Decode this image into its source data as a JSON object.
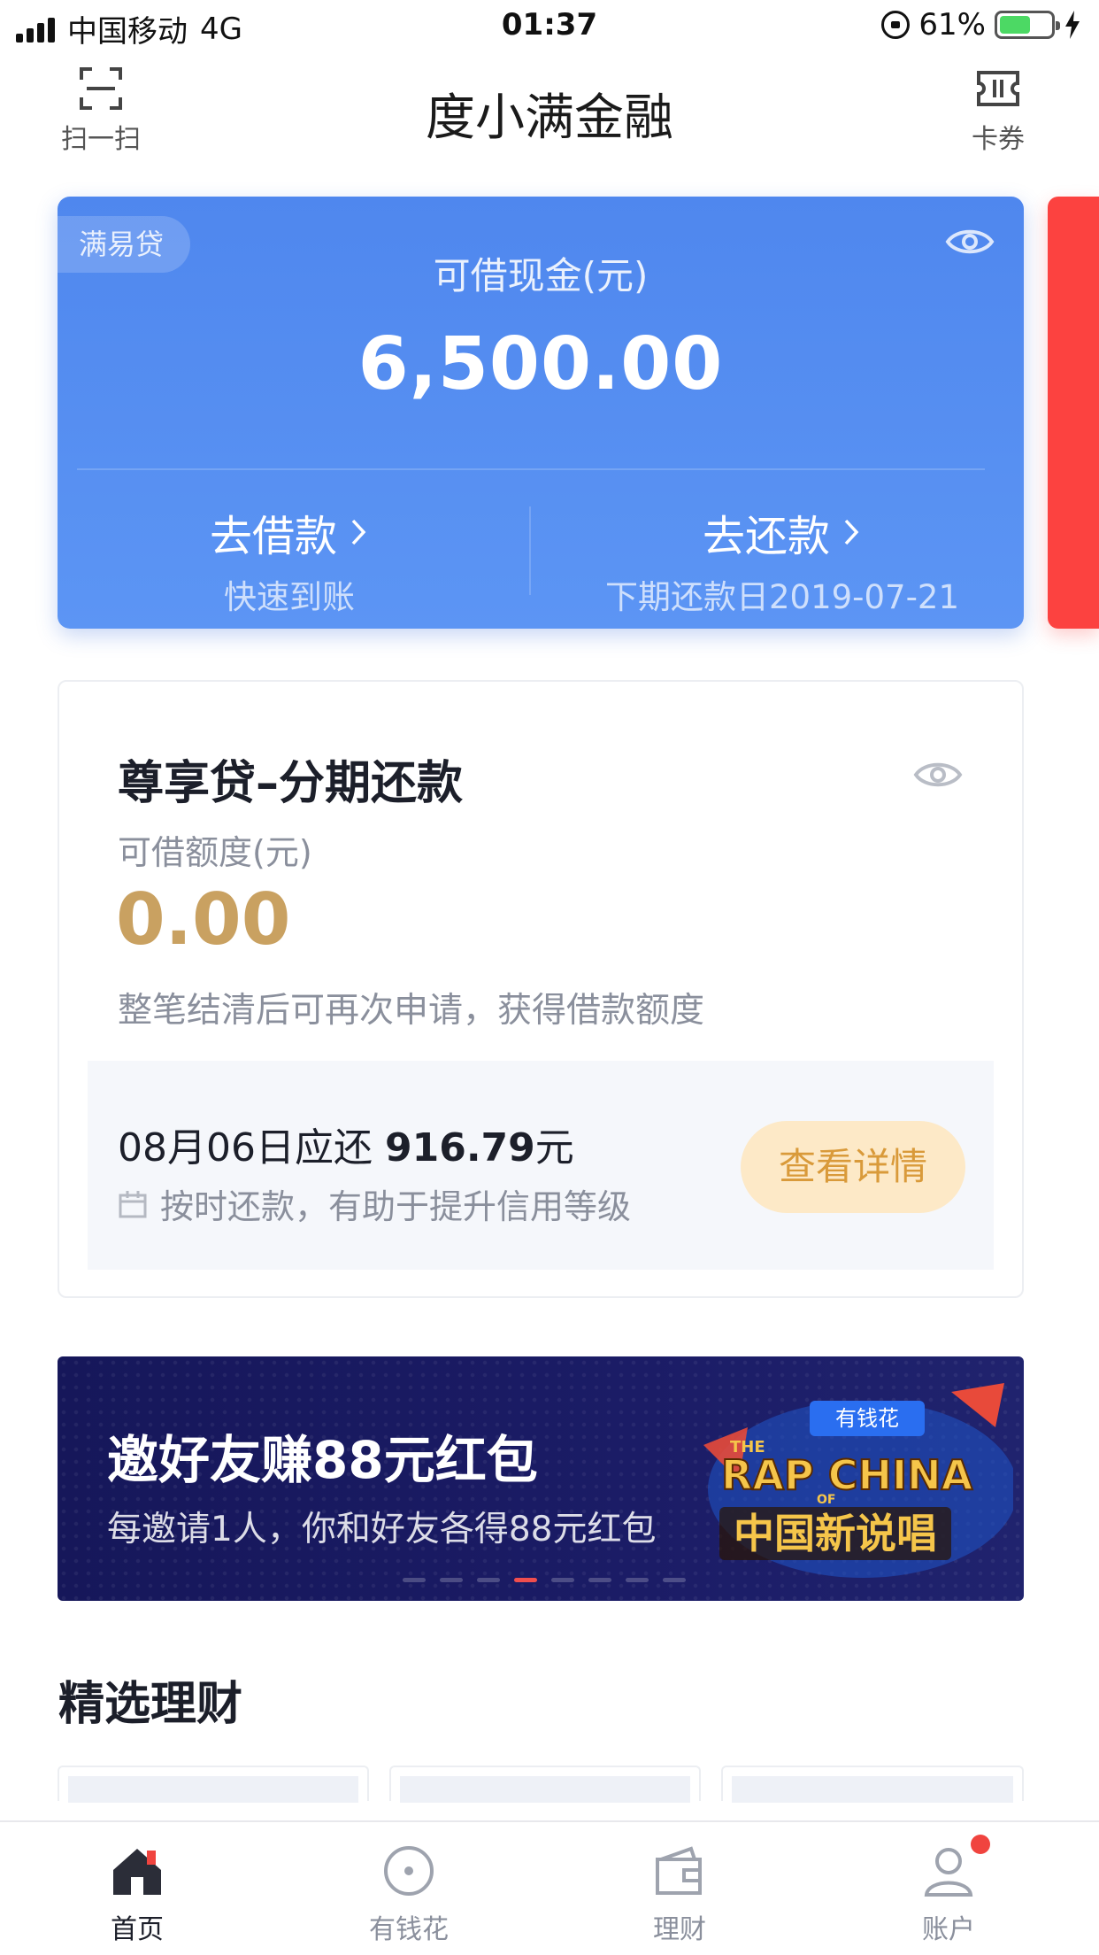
{
  "status_bar": {
    "carrier": "中国移动",
    "network": "4G",
    "time": "01:37",
    "battery": "61%",
    "battery_level": 0.61
  },
  "header": {
    "title": "度小满金融",
    "scan_label": "扫一扫",
    "coupon_label": "卡券"
  },
  "cash_card": {
    "tag": "满易贷",
    "label": "可借现金(元)",
    "amount": "6,500.00",
    "borrow": {
      "title": "去借款",
      "subtitle": "快速到账"
    },
    "repay": {
      "title": "去还款",
      "subtitle": "下期还款日2019-07-21"
    },
    "colors": {
      "background": "#5a92f3",
      "peek_card": "#fc4240"
    }
  },
  "loan_card": {
    "title": "尊享贷–分期还款",
    "label": "可借额度(元)",
    "amount": "0.00",
    "hint": "整笔结清后可再次申请，获得借款额度",
    "due_date_text": "08月06日应还",
    "due_amount": "916.79",
    "due_unit": "元",
    "due_tip": "按时还款，有助于提升信用等级",
    "detail_button": "查看详情",
    "colors": {
      "amount": "#c9a161",
      "button_bg": "#fde9c7",
      "button_text": "#d99a3a"
    }
  },
  "banner": {
    "title": "邀好友赚88元红包",
    "subtitle": "每邀请1人，你和好友各得88元红包",
    "badge": "有钱花",
    "art_top": "THE",
    "art_main": "RAP CHINA",
    "art_of": "OF",
    "art_cn": "中国新说唱",
    "active_slide": 4,
    "slide_count": 8
  },
  "section": {
    "title": "精选理财"
  },
  "tab_bar": {
    "items": [
      {
        "label": "首页",
        "icon": "home-icon",
        "active": true
      },
      {
        "label": "有钱花",
        "icon": "coin-circle-icon",
        "active": false
      },
      {
        "label": "理财",
        "icon": "wallet-icon",
        "active": false
      },
      {
        "label": "账户",
        "icon": "user-icon",
        "active": false,
        "badge": true
      }
    ]
  }
}
